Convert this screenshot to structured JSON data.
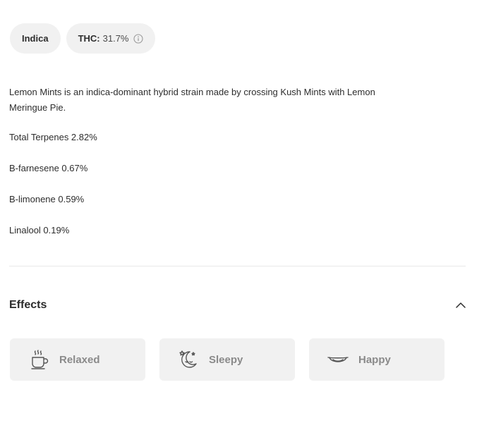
{
  "chips": {
    "type": "Indica",
    "thc_label": "THC:",
    "thc_value": "31.7%",
    "info_icon": "info-icon"
  },
  "description": "Lemon Mints is an indica-dominant hybrid strain made by crossing Kush Mints with Lemon Meringue Pie.",
  "terpenes": {
    "total": "Total Terpenes 2.82%",
    "items": [
      "B-farnesene 0.67%",
      "B-limonene 0.59%",
      "Linalool 0.19%"
    ]
  },
  "effects": {
    "title": "Effects",
    "toggle_icon": "chevron-up-icon",
    "items": [
      {
        "label": "Relaxed",
        "icon": "tea-cup-icon"
      },
      {
        "label": "Sleepy",
        "icon": "moon-stars-icon"
      },
      {
        "label": "Happy",
        "icon": "smile-icon"
      }
    ]
  },
  "colors": {
    "chip_bg": "#f1f1f1",
    "card_bg": "#f1f1f1",
    "muted_text": "#8a8a8a",
    "divider": "#e9e9e9"
  }
}
